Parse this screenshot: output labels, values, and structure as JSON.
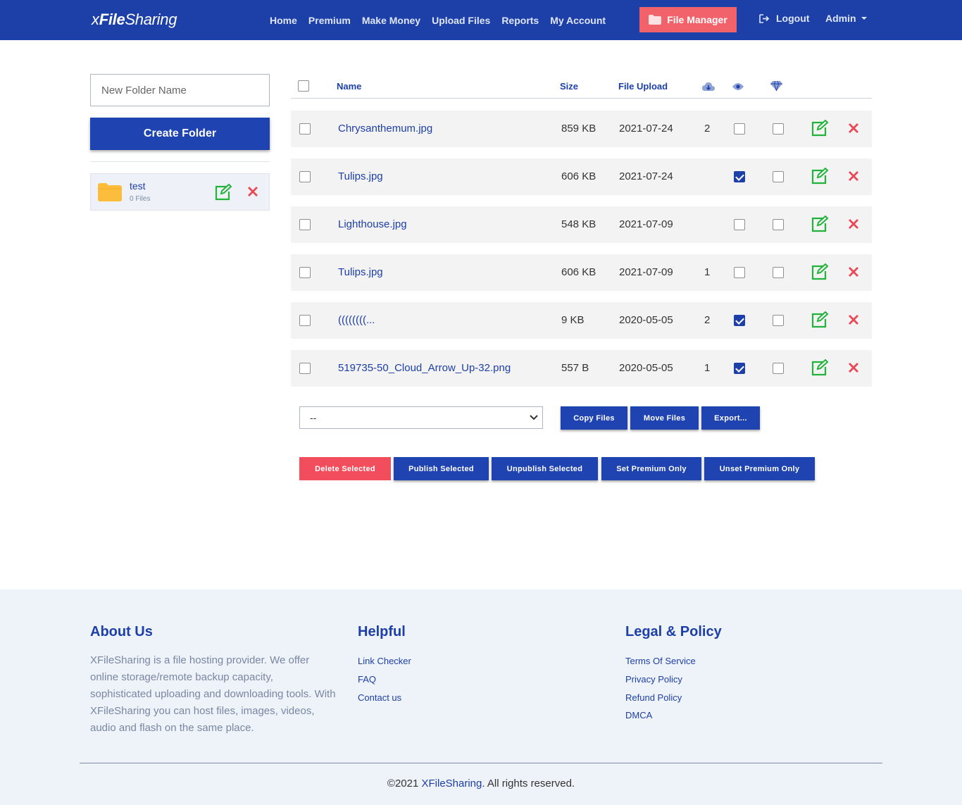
{
  "nav": {
    "logo_prefix": "x",
    "logo_bold": "File",
    "logo_suffix": "Sharing",
    "links": [
      "Home",
      "Premium",
      "Make Money",
      "Upload Files",
      "Reports",
      "My Account"
    ],
    "file_manager": "File Manager",
    "logout": "Logout",
    "admin": "Admin"
  },
  "sidebar": {
    "folder_placeholder": "New Folder Name",
    "create_button": "Create Folder",
    "folders": [
      {
        "name": "test",
        "count": "0 Files"
      }
    ]
  },
  "table": {
    "headers": {
      "name": "Name",
      "size": "Size",
      "upload": "File Upload"
    },
    "header_icons": [
      "download-cloud-icon",
      "eye-icon",
      "diamond-icon"
    ],
    "rows": [
      {
        "name": "Chrysanthemum.jpg",
        "size": "859 KB",
        "date": "2021-07-24",
        "downloads": "2",
        "public": false,
        "premium": false
      },
      {
        "name": "Tulips.jpg",
        "size": "606 KB",
        "date": "2021-07-24",
        "downloads": "",
        "public": true,
        "premium": false
      },
      {
        "name": "Lighthouse.jpg",
        "size": "548 KB",
        "date": "2021-07-09",
        "downloads": "",
        "public": false,
        "premium": false
      },
      {
        "name": "Tulips.jpg",
        "size": "606 KB",
        "date": "2021-07-09",
        "downloads": "1",
        "public": false,
        "premium": false
      },
      {
        "name": "((((((((...",
        "size": "9 KB",
        "date": "2020-05-05",
        "downloads": "2",
        "public": true,
        "premium": false
      },
      {
        "name": "519735-50_Cloud_Arrow_Up-32.png",
        "size": "557 B",
        "date": "2020-05-05",
        "downloads": "1",
        "public": true,
        "premium": false
      }
    ]
  },
  "actions": {
    "select_value": "--",
    "copy": "Copy Files",
    "move": "Move Files",
    "export": "Export...",
    "delete_selected": "Delete Selected",
    "publish_selected": "Publish Selected",
    "unpublish_selected": "Unpublish Selected",
    "set_premium": "Set Premium Only",
    "unset_premium": "Unset Premium Only"
  },
  "footer": {
    "about_title": "About Us",
    "about_text": "XFileSharing is a file hosting provider. We offer online storage/remote backup capacity, sophisticated uploading and downloading tools. With XFileSharing you can host files, images, videos, audio and flash on the same place.",
    "helpful_title": "Helpful",
    "helpful_links": [
      "Link Checker",
      "FAQ",
      "Contact us"
    ],
    "legal_title": "Legal & Policy",
    "legal_links": [
      "Terms Of Service",
      "Privacy Policy",
      "Refund Policy",
      "DMCA"
    ],
    "copyright_prefix": "©2021 ",
    "copyright_brand": "XFileSharing",
    "copyright_suffix": ". All rights reserved."
  },
  "colors": {
    "primary": "#1c3fa8",
    "danger": "#f24d5c",
    "success": "#22b33a",
    "folder": "#fbbd3b"
  }
}
